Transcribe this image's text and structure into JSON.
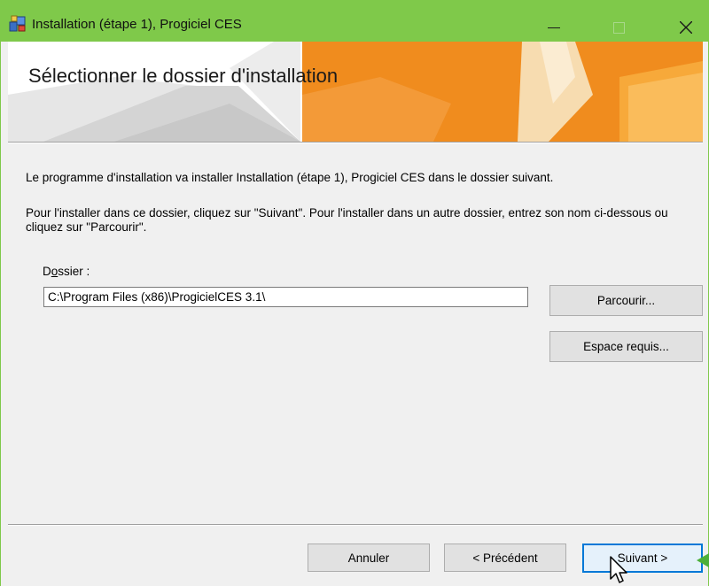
{
  "window": {
    "title": "Installation (étape 1), Progiciel CES",
    "accent_color": "#7fc94a"
  },
  "titlebar_icons": [
    "installer-icon",
    "minimize-icon",
    "maximize-icon",
    "close-icon"
  ],
  "banner": {
    "heading": "Sélectionner le dossier d'installation",
    "art_color": "#f08c1e"
  },
  "content": {
    "intro": "Le programme d'installation va installer Installation (étape 1), Progiciel CES dans le dossier suivant.",
    "instructions": "Pour l'installer dans ce dossier, cliquez sur \"Suivant\". Pour l'installer dans un autre dossier, entrez son nom ci-dessous ou cliquez sur \"Parcourir\".",
    "folder_label_prefix": "D",
    "folder_label_underlined": "o",
    "folder_label_rest": "ssier :",
    "folder_value": "C:\\Program Files (x86)\\ProgicielCES 3.1\\",
    "browse_button": "Parcourir...",
    "space_button": "Espace requis..."
  },
  "footer": {
    "cancel_button": "Annuler",
    "back_button": "< Précédent",
    "next_button": "Suivant >"
  }
}
